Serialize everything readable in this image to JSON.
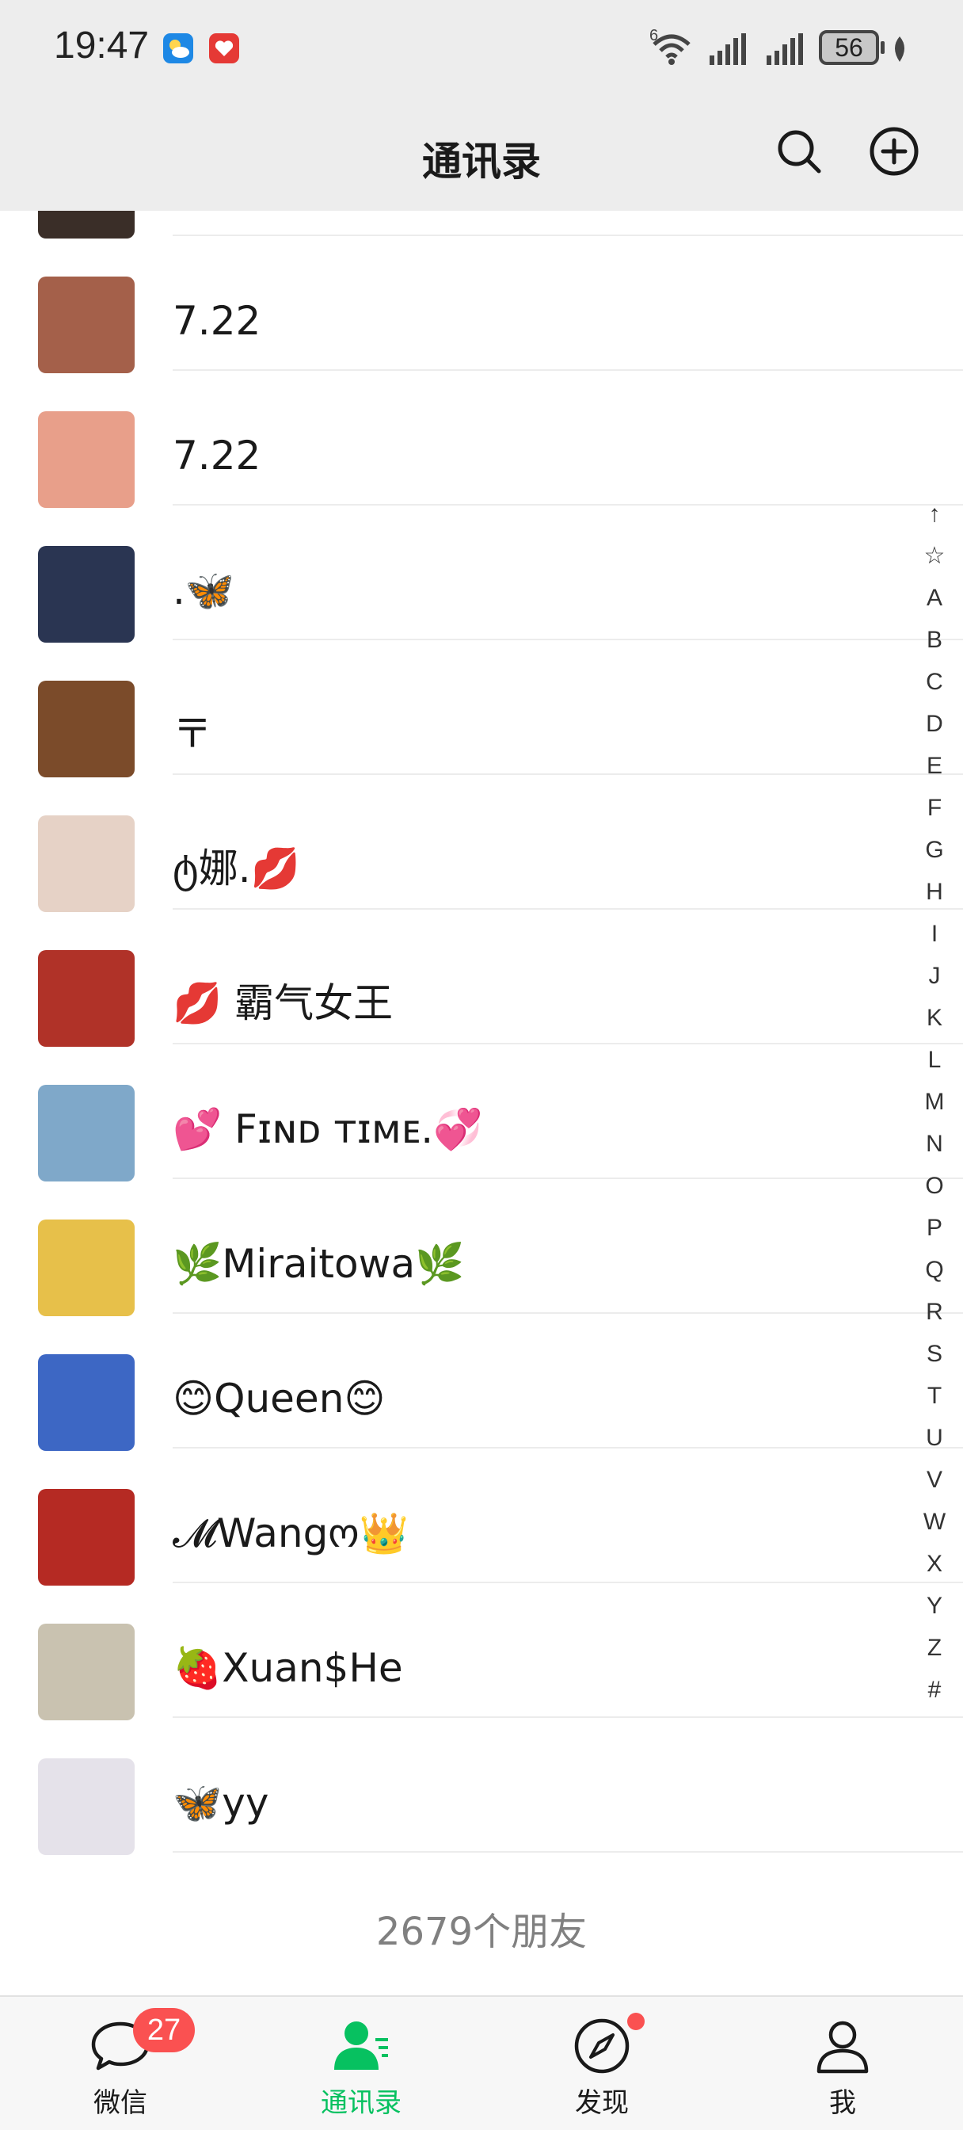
{
  "status_bar": {
    "time": "19:47",
    "network": "6",
    "battery": "56",
    "icons": [
      "weather-app-icon",
      "health-app-icon",
      "wifi-icon",
      "signal-icon",
      "signal-icon",
      "battery-icon",
      "leaf-icon"
    ]
  },
  "header": {
    "title": "通讯录",
    "search_icon": "search-icon",
    "add_icon": "plus-circle-icon"
  },
  "contacts": [
    {
      "name": "7.22",
      "avatar_color": "#a4604a"
    },
    {
      "name": "7.22",
      "avatar_color": "#e89f8a"
    },
    {
      "name": ".🦋",
      "avatar_color": "#2a3552"
    },
    {
      "name": "〒",
      "avatar_color": "#7b4b2a"
    },
    {
      "name": "ტ娜.💋",
      "avatar_color": "#e6d2c6"
    },
    {
      "name": "💋 霸气女王",
      "avatar_color": "#b03228"
    },
    {
      "name": "💕 Fɪɴᴅ ᴛɪᴍᴇ.💞",
      "avatar_color": "#7fa8c9"
    },
    {
      "name": "🌿Miraitowa🌿",
      "avatar_color": "#e7c04a"
    },
    {
      "name": "😊Queen😊",
      "avatar_color": "#3d67c4"
    },
    {
      "name": "𝓜Wangო👑",
      "avatar_color": "#b52a23"
    },
    {
      "name": "🍓Xuan$He",
      "avatar_color": "#c9c2b0"
    },
    {
      "name": "🦋yy",
      "avatar_color": "#e5e2ea"
    }
  ],
  "footer": {
    "count_text": "2679个朋友"
  },
  "index_bar": [
    "↑",
    "☆",
    "A",
    "B",
    "C",
    "D",
    "E",
    "F",
    "G",
    "H",
    "I",
    "J",
    "K",
    "L",
    "M",
    "N",
    "O",
    "P",
    "Q",
    "R",
    "S",
    "T",
    "U",
    "V",
    "W",
    "X",
    "Y",
    "Z",
    "#"
  ],
  "tabs": [
    {
      "label": "微信",
      "badge": "27",
      "icon": "chat-bubble-icon",
      "active": false
    },
    {
      "label": "通讯录",
      "icon": "contacts-icon",
      "active": true
    },
    {
      "label": "发现",
      "icon": "compass-icon",
      "active": false,
      "dot": true
    },
    {
      "label": "我",
      "icon": "person-icon",
      "active": false
    }
  ],
  "colors": {
    "accent": "#07c160",
    "badge": "#fa5151",
    "header_bg": "#ededed"
  }
}
